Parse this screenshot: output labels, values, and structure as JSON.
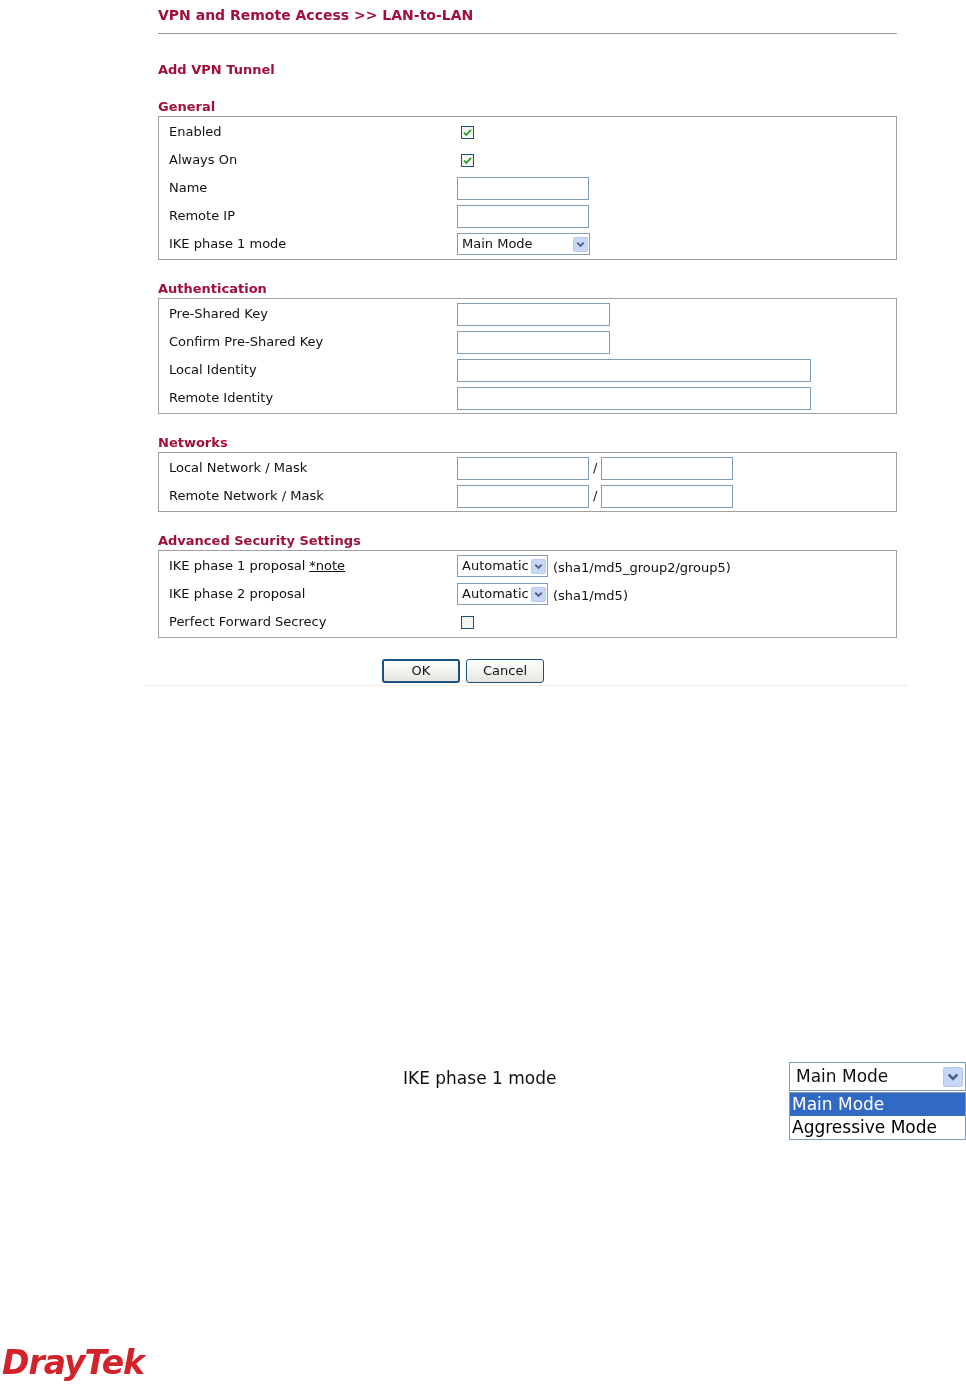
{
  "breadcrumb": "VPN and Remote Access >> LAN-to-LAN",
  "heading": "Add VPN Tunnel",
  "sections": [
    {
      "title": "General",
      "rows": [
        {
          "label": "Enabled",
          "kind": "checkbox",
          "checked": true
        },
        {
          "label": "Always On",
          "kind": "checkbox",
          "checked": true
        },
        {
          "label": "Name",
          "kind": "shortfield"
        },
        {
          "label": "Remote IP",
          "kind": "shortfield"
        },
        {
          "label": "IKE phase 1 mode",
          "kind": "modeselect",
          "value": "Main Mode"
        }
      ]
    },
    {
      "title": "Authentication",
      "rows": [
        {
          "label": "Pre-Shared Key",
          "kind": "keyfield"
        },
        {
          "label": "Confirm Pre-Shared Key",
          "kind": "keyfield"
        },
        {
          "label": "Local Identity",
          "kind": "longfield"
        },
        {
          "label": "Remote Identity",
          "kind": "longfield"
        }
      ]
    },
    {
      "title": "Networks",
      "rows": [
        {
          "label": "Local Network / Mask",
          "kind": "network",
          "separator": "/"
        },
        {
          "label": "Remote Network / Mask",
          "kind": "network",
          "separator": "/"
        }
      ]
    },
    {
      "title": "Advanced Security Settings",
      "rows": [
        {
          "label": "IKE phase 1 proposal",
          "link": "*note",
          "kind": "proposalselect",
          "value": "Automatic",
          "hint": "(sha1/md5_group2/group5)"
        },
        {
          "label": "IKE phase 2 proposal",
          "kind": "proposalselect",
          "value": "Automatic",
          "hint": "(sha1/md5)"
        },
        {
          "label": "Perfect Forward Secrecy",
          "kind": "checkbox",
          "checked": false
        }
      ]
    }
  ],
  "buttons": [
    "OK",
    "Cancel"
  ],
  "callout": {
    "label": "IKE phase 1 mode",
    "value": "Main Mode",
    "options": [
      {
        "label": "Main Mode",
        "selected": true
      },
      {
        "label": "Aggressive Mode",
        "selected": false
      }
    ]
  },
  "logo": "DrayTek"
}
